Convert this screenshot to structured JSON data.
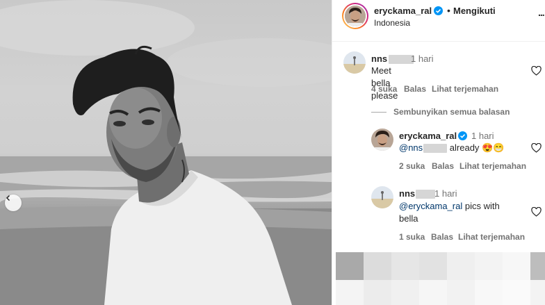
{
  "header": {
    "username": "eryckama_ral",
    "separator": "•",
    "follow_label": "Mengikuti",
    "location": "Indonesia",
    "more": "..."
  },
  "comments": [
    {
      "username": "nns",
      "time": "1 hari",
      "text": "Meet bella please",
      "likes": "4 suka",
      "reply": "Balas",
      "translate": "Lihat terjemahan"
    }
  ],
  "hide_replies_label": "Sembunyikan semua balasan",
  "replies": [
    {
      "username": "eryckama_ral",
      "time": "1 hari",
      "mention": "@nns",
      "text": "already",
      "emojis": "😍😁",
      "likes": "2 suka",
      "reply": "Balas",
      "translate": "Lihat terjemahan"
    },
    {
      "username": "nns",
      "time": "1 hari",
      "mention": "@eryckama_ral",
      "text_line1": " pics with",
      "text_line2": "bella",
      "likes": "1 suka",
      "reply": "Balas",
      "translate": "Lihat terjemahan"
    }
  ],
  "icons": {
    "verified": "verified-badge-icon",
    "heart": "heart-outline-icon",
    "carousel_prev": "chevron-left-icon"
  },
  "colors": {
    "verified_blue": "#0095f6",
    "secondary_text": "#737373",
    "mention": "#00376b"
  }
}
